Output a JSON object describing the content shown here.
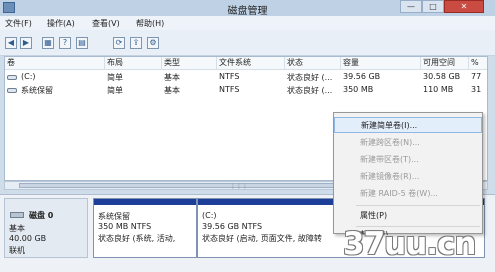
{
  "window": {
    "title": "磁盘管理",
    "buttons": {
      "minimize": "—",
      "maximize": "□",
      "close": "✕"
    }
  },
  "menu": [
    "文件(F)",
    "操作(A)",
    "查看(V)",
    "帮助(H)"
  ],
  "toolbar": {
    "icons": [
      "back-icon",
      "forward-icon",
      "list-view-icon",
      "help-icon",
      "properties-icon",
      "refresh-icon",
      "export-icon",
      "settings-icon"
    ],
    "glyphs": [
      "◀",
      "▶",
      "▦",
      "?",
      "▤",
      "⟳",
      "⇪",
      "⚙"
    ]
  },
  "volumes": {
    "columns": [
      "卷",
      "布局",
      "类型",
      "文件系统",
      "状态",
      "容量",
      "可用空间",
      "%"
    ],
    "rows": [
      [
        "(C:)",
        "简单",
        "基本",
        "NTFS",
        "状态良好 (...",
        "39.56 GB",
        "30.58 GB",
        "77"
      ],
      [
        "系统保留",
        "简单",
        "基本",
        "NTFS",
        "状态良好 (...",
        "350 MB",
        "110 MB",
        "31"
      ]
    ]
  },
  "disk": {
    "name": "磁盘 0",
    "type": "基本",
    "size": "40.00 GB",
    "status": "联机",
    "partitions": [
      {
        "name": "系统保留",
        "size_fs": "350 MB NTFS",
        "status": "状态良好 (系统, 活动,"
      },
      {
        "name": "(C:)",
        "size_fs": "39.56 GB NTFS",
        "status": "状态良好 (启动, 页面文件, 故障转"
      }
    ]
  },
  "context_menu": {
    "items": [
      {
        "label": "新建简单卷(I)...",
        "enabled": true
      },
      {
        "label": "新建跨区卷(N)...",
        "enabled": false
      },
      {
        "label": "新建带区卷(T)...",
        "enabled": false
      },
      {
        "label": "新建镜像卷(R)...",
        "enabled": false
      },
      {
        "label": "新建 RAID-5 卷(W)...",
        "enabled": false
      },
      {
        "label": "属性(P)",
        "enabled": true
      },
      {
        "label": "帮助(H)",
        "enabled": true
      }
    ]
  },
  "watermark": "37uu.cn",
  "colors": {
    "partition_header": "#1d3f9a",
    "menu_highlight": "#e3eefb"
  }
}
